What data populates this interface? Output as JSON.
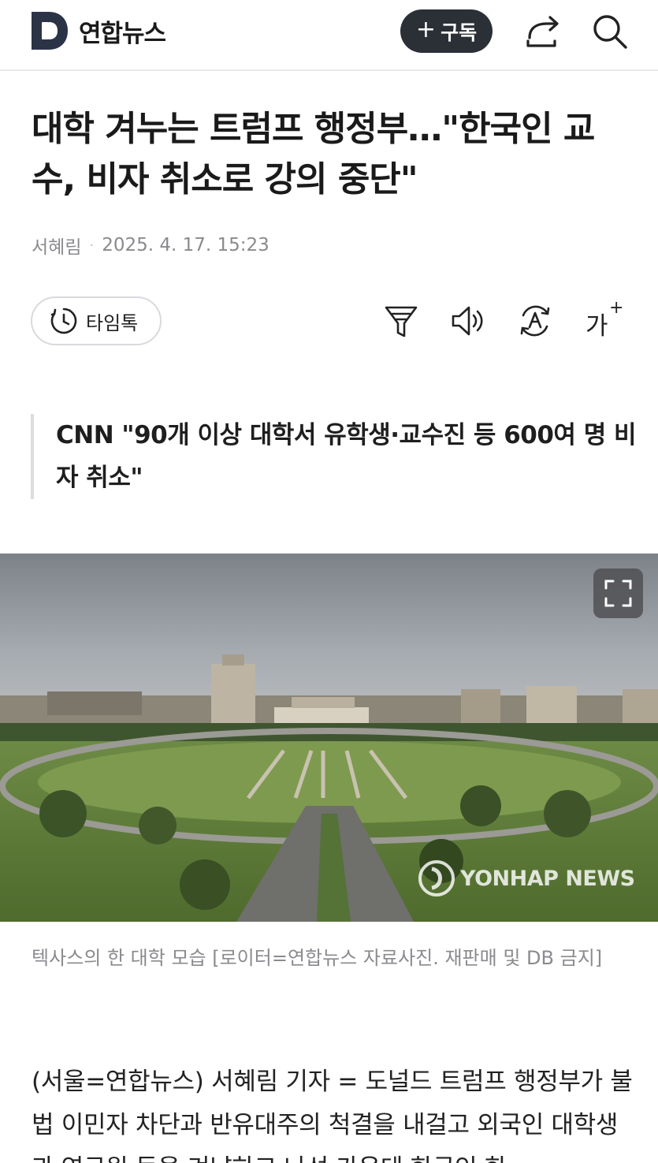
{
  "header": {
    "logo_letter": "D",
    "brand": "연합뉴스",
    "subscribe_plus": "+",
    "subscribe_label": "구독"
  },
  "article": {
    "headline": "대학 겨누는 트럼프 행정부…\"한국인 교수, 비자 취소로 강의 중단\"",
    "author": "서혜림",
    "date": "2025. 4. 17. 15:23",
    "timetalk_label": "타임톡",
    "font_size_label": "가",
    "subheadline": "CNN \"90개 이상 대학서 유학생·교수진 등 600여 명 비자 취소\"",
    "photo": {
      "watermark": "YONHAP NEWS",
      "caption": "텍사스의 한 대학 모습 [로이터=연합뉴스 자료사진. 재판매 및 DB 금지]"
    },
    "body": "(서울=연합뉴스) 서혜림 기자 = 도널드 트럼프 행정부가 불법 이민자 차단과 반유대주의 척결을 내걸고 외국인 대학생과 연구원 등을 겨냥하고 나선 가운데 한국인 한"
  },
  "icons": {
    "share": "share-icon",
    "search": "search-icon",
    "clock": "clock-icon",
    "filter": "filter-icon",
    "speaker": "speaker-icon",
    "translate": "translate-icon",
    "font_size": "font-size-icon",
    "expand": "expand-icon"
  },
  "colors": {
    "subscribe_bg": "#2b2f36",
    "logo": "#2b3447",
    "meta_text": "#8a8a8f"
  }
}
